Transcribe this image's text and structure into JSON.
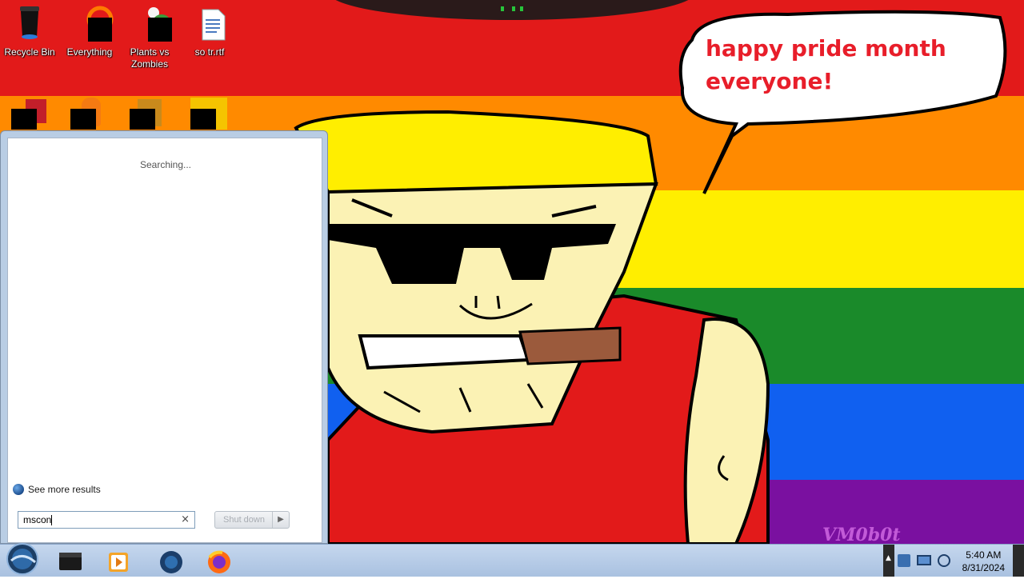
{
  "wallpaper": {
    "speech_bubble_text": "happy pride month everyone!",
    "signature": "VM0b0t",
    "stripe_colors": [
      "#e21a1a",
      "#ff8a00",
      "#ffee00",
      "#1a8a2a",
      "#1060f0",
      "#7a10a0"
    ]
  },
  "desktop_icons": [
    {
      "label": "Recycle Bin",
      "icon": "recycle-bin-icon"
    },
    {
      "label": "Everything",
      "icon": "everything-icon"
    },
    {
      "label": "Plants vs Zombies",
      "icon": "plants-vs-zombies-icon"
    },
    {
      "label": "so tr.rtf",
      "icon": "rtf-document-icon"
    }
  ],
  "start_menu": {
    "status_text": "Searching...",
    "see_more_label": "See more results",
    "search_value": "mscon",
    "clear_glyph": "×",
    "shutdown_label": "Shut down",
    "shutdown_arrow": "▶"
  },
  "taskbar": {
    "pinned": [
      "explorer-icon",
      "media-player-icon",
      "internet-explorer-icon",
      "firefox-icon"
    ]
  },
  "tray": {
    "time": "5:40 AM",
    "date": "8/31/2024"
  }
}
